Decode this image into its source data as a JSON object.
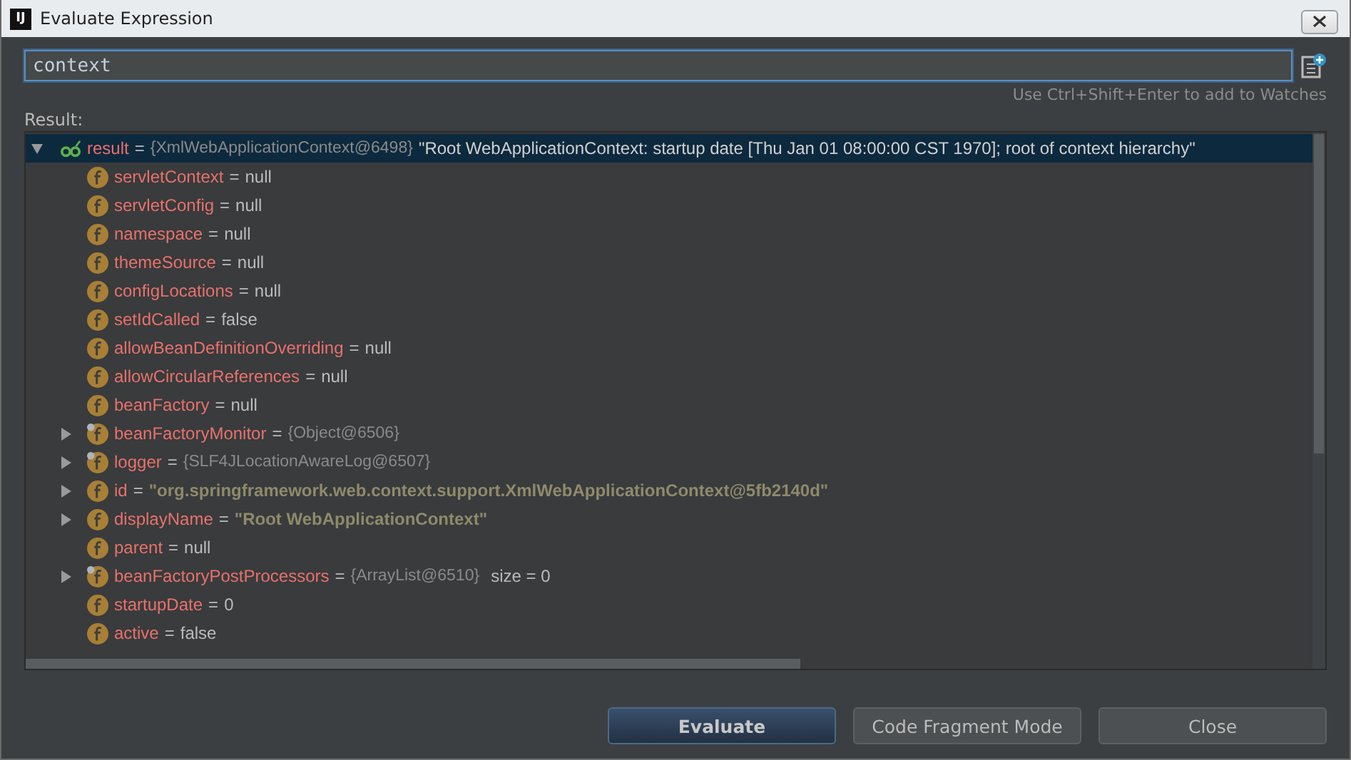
{
  "window": {
    "logo": "IJ",
    "title": "Evaluate Expression"
  },
  "expression": {
    "value": "context",
    "hint": "Use Ctrl+Shift+Enter to add to Watches"
  },
  "result_label": "Result:",
  "tree": {
    "root": {
      "name": "result",
      "sep": "=",
      "type": "{XmlWebApplicationContext@6498}",
      "value": "\"Root WebApplicationContext: startup date [Thu Jan 01 08:00:00 CST 1970]; root of context hierarchy\"",
      "expanded": true,
      "selected": true
    },
    "children": [
      {
        "name": "servletContext",
        "sep": "=",
        "value": "null",
        "kind": "plain",
        "expandable": false,
        "badge": false
      },
      {
        "name": "servletConfig",
        "sep": "=",
        "value": "null",
        "kind": "plain",
        "expandable": false,
        "badge": false
      },
      {
        "name": "namespace",
        "sep": "=",
        "value": "null",
        "kind": "plain",
        "expandable": false,
        "badge": false
      },
      {
        "name": "themeSource",
        "sep": "=",
        "value": "null",
        "kind": "plain",
        "expandable": false,
        "badge": false
      },
      {
        "name": "configLocations",
        "sep": "=",
        "value": "null",
        "kind": "plain",
        "expandable": false,
        "badge": false
      },
      {
        "name": "setIdCalled",
        "sep": "=",
        "value": "false",
        "kind": "plain",
        "expandable": false,
        "badge": false
      },
      {
        "name": "allowBeanDefinitionOverriding",
        "sep": "=",
        "value": "null",
        "kind": "plain",
        "expandable": false,
        "badge": false
      },
      {
        "name": "allowCircularReferences",
        "sep": "=",
        "value": "null",
        "kind": "plain",
        "expandable": false,
        "badge": false
      },
      {
        "name": "beanFactory",
        "sep": "=",
        "value": "null",
        "kind": "plain",
        "expandable": false,
        "badge": false
      },
      {
        "name": "beanFactoryMonitor",
        "sep": "=",
        "value": "{Object@6506}",
        "kind": "object",
        "expandable": true,
        "badge": true
      },
      {
        "name": "logger",
        "sep": "=",
        "value": "{SLF4JLocationAwareLog@6507}",
        "kind": "object",
        "expandable": true,
        "badge": true
      },
      {
        "name": "id",
        "sep": "=",
        "value": "\"org.springframework.web.context.support.XmlWebApplicationContext@5fb2140d\"",
        "kind": "string",
        "expandable": true,
        "badge": false
      },
      {
        "name": "displayName",
        "sep": "=",
        "value": "\"Root WebApplicationContext\"",
        "kind": "string",
        "expandable": true,
        "badge": false
      },
      {
        "name": "parent",
        "sep": "=",
        "value": "null",
        "kind": "plain",
        "expandable": false,
        "badge": false
      },
      {
        "name": "beanFactoryPostProcessors",
        "sep": "=",
        "value": "{ArrayList@6510}",
        "kind": "object",
        "extra": "size = 0",
        "expandable": true,
        "badge": true
      },
      {
        "name": "startupDate",
        "sep": "=",
        "value": "0",
        "kind": "plain",
        "expandable": false,
        "badge": false
      },
      {
        "name": "active",
        "sep": "=",
        "value": "false",
        "kind": "plain",
        "expandable": false,
        "badge": false
      }
    ]
  },
  "buttons": [
    {
      "label": "Evaluate",
      "default": true
    },
    {
      "label": "Code Fragment Mode",
      "default": false
    },
    {
      "label": "Close",
      "default": false
    }
  ]
}
